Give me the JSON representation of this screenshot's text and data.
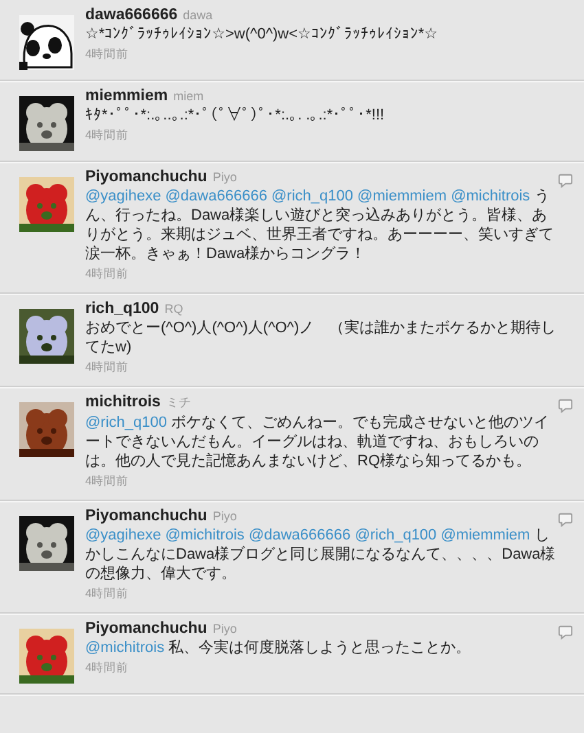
{
  "tweets": [
    {
      "name": "dawa666666",
      "handle": "dawa",
      "avatar": {
        "kind": "panda"
      },
      "text": "☆*ｺﾝｸﾞﾗｯﾁｩﾚｲｼｮﾝ☆>w(^0^)w<☆ｺﾝｸﾞﾗｯﾁｩﾚｲｼｮﾝ*☆",
      "time": "4時間前",
      "reply_button": false
    },
    {
      "name": "miemmiem",
      "handle": "miem",
      "text": "ｷﾀ*･ﾟﾟ･*:.｡..｡.:*･ﾟ(ﾟ∀ﾟ)ﾟ･*:.｡. .｡.:*･ﾟﾟ･*!!!",
      "time": "4時間前",
      "reply_button": false
    },
    {
      "name": "Piyomanchuchu",
      "handle": "Piyo",
      "mentions": [
        "@yagihexe",
        "@dawa666666",
        "@rich_q100",
        "@miemmiem",
        "@michitrois"
      ],
      "text": "うん、行ったね。Dawa様楽しい遊びと突っ込みありがとう。皆様、ありがとう。来期はジュベ、世界王者ですね。あーーーー、笑いすぎて涙一杯。きゃぁ！Dawa様からコングラ！",
      "time": "4時間前",
      "reply_button": true
    },
    {
      "name": "rich_q100",
      "handle": "RQ",
      "text": "おめでとー(^O^)人(^O^)人(^O^)ノ　（実は誰かまたボケるかと期待してたw)",
      "time": "4時間前",
      "reply_button": false
    },
    {
      "name": "michitrois",
      "handle": "ミチ",
      "mentions": [
        "@rich_q100"
      ],
      "text": "ボケなくて、ごめんねー。でも完成させないと他のツイートできないんだもん。イーグルはね、軌道ですね、おもしろいのは。他の人で見た記憶あんまないけど、RQ様なら知ってるかも。",
      "time": "4時間前",
      "reply_button": true
    },
    {
      "name": "Piyomanchuchu",
      "handle": "Piyo",
      "mentions": [
        "@yagihexe",
        "@michitrois",
        "@dawa666666",
        "@rich_q100",
        "@miemmiem"
      ],
      "text": "しかしこんなにDawa様ブログと同じ展開になるなんて、、、、Dawa様の想像力、偉大です。",
      "time": "4時間前",
      "reply_button": true
    },
    {
      "name": "Piyomanchuchu",
      "handle": "Piyo",
      "mentions": [
        "@michitrois"
      ],
      "text": "私、今実は何度脱落しようと思ったことか。",
      "time": "4時間前",
      "reply_button": true
    }
  ]
}
